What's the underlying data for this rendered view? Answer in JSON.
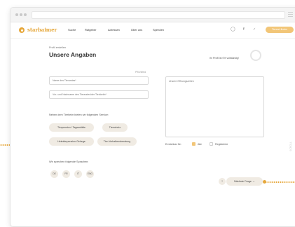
{
  "nav": {
    "logo": "starbaimer",
    "links": [
      "Suche",
      "Ratgeber",
      "Adressen",
      "Über uns",
      "Spenden"
    ],
    "icons": [
      "lock-icon",
      "facebook-icon",
      "twitter-icon"
    ],
    "cta": "Tierarzt finden"
  },
  "profile": {
    "breadcrumb": "Profil erstellen",
    "title": "Unsere Angaben",
    "status": "Ihr Profil ist 0% vollständig!"
  },
  "form": {
    "required_note": "Pflichtfeld",
    "name_placeholder": "Name des Tierarztes*",
    "address_placeholder": "Vor- und Nachname des Tierarztes/der Tierärztin*",
    "hours_placeholder": "Unsere Öffnungszeiten",
    "services_label": "Neben dem Tierheim bieten wir folgenden Service:",
    "services": [
      "Tierpension / Tagesstätte",
      "Tierschutz",
      "Heimtierpension Gehege",
      "Tier-Verhaltensberatung"
    ],
    "languages_label": "Wir sprechen folgende Sprachen:",
    "languages": [
      "DE",
      "FR",
      "IT",
      "ENG"
    ],
    "reachable_label": "Erreichbar für:",
    "reachable_options": [
      "Alle",
      "Registrierte"
    ],
    "reachable_checked": [
      true,
      false
    ]
  },
  "footer": {
    "help": "?",
    "next": "Nächste Frage",
    "next_arrow": "→"
  },
  "side_label": "SCROLL",
  "colors": {
    "accent": "#e6a83c",
    "chip": "#f0ebe3"
  }
}
